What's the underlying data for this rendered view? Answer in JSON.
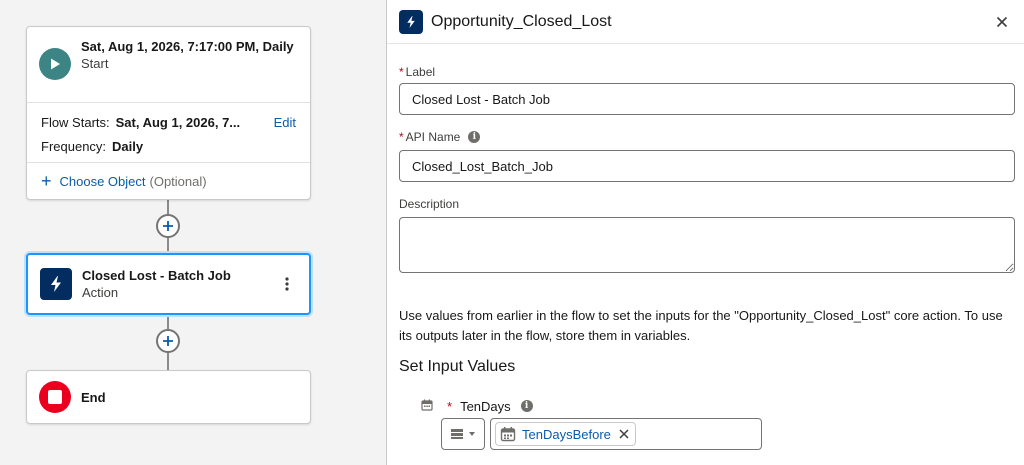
{
  "canvas": {
    "start": {
      "title": "Sat, Aug 1, 2026, 7:17:00 PM, Daily",
      "subtitle": "Start",
      "flow_starts_label": "Flow Starts:",
      "flow_starts_value": "Sat, Aug 1, 2026, 7...",
      "edit_label": "Edit",
      "frequency_label": "Frequency:",
      "frequency_value": "Daily",
      "choose_object_label": "Choose Object",
      "choose_object_optional": "(Optional)"
    },
    "action": {
      "title": "Closed Lost - Batch Job",
      "subtitle": "Action"
    },
    "end": {
      "title": "End"
    }
  },
  "panel": {
    "title": "Opportunity_Closed_Lost",
    "label_field": {
      "label": "Label",
      "value": "Closed Lost - Batch Job"
    },
    "api_name_field": {
      "label": "API Name",
      "value": "Closed_Lost_Batch_Job"
    },
    "description_field": {
      "label": "Description",
      "value": ""
    },
    "help_text": "Use values from earlier in the flow to set the inputs for the \"Opportunity_Closed_Lost\" core action. To use its outputs later in the flow, store them in variables.",
    "section_title": "Set Input Values",
    "inputs": [
      {
        "label": "TenDays",
        "value": "TenDaysBefore"
      }
    ]
  },
  "colors": {
    "start_icon": "#3d8484",
    "action_icon": "#032d60",
    "end_icon": "#ea001e",
    "link": "#0b5cab",
    "selected_border": "#1b96ff"
  }
}
